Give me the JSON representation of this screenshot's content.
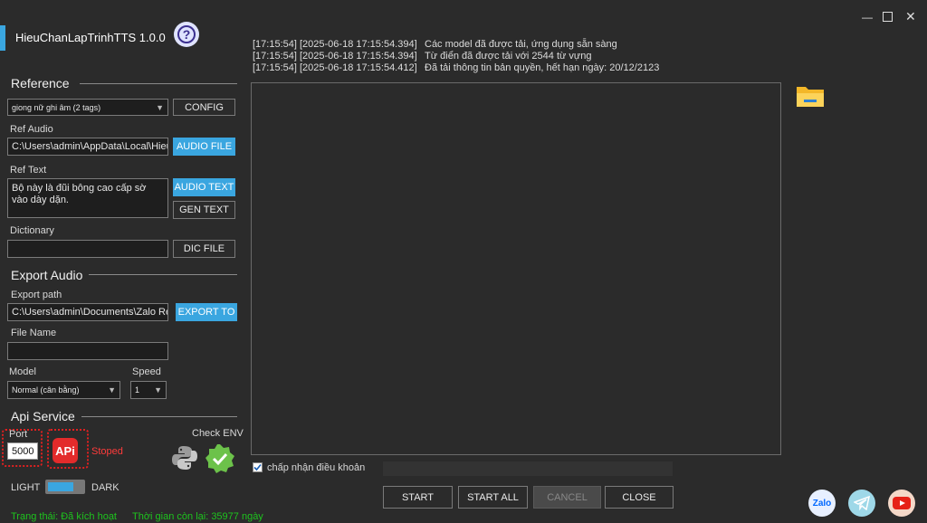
{
  "app": {
    "title": "HieuChanLapTrinhTTS 1.0.0"
  },
  "reference": {
    "heading": "Reference",
    "voice_select": "giong nữ ghi âm (2 tags)",
    "config_btn": "CONFIG",
    "ref_audio_label": "Ref Audio",
    "ref_audio_value": "C:\\Users\\admin\\AppData\\Local\\Hieu(",
    "audio_file_btn": "AUDIO FILE",
    "ref_text_label": "Ref Text",
    "ref_text_value": "Bộ này là đũi bông cao cấp sờ vào dày dặn.",
    "audio_text_btn": "AUDIO TEXT",
    "gen_text_btn": "GEN TEXT",
    "dictionary_label": "Dictionary",
    "dictionary_value": "",
    "dic_file_btn": "DIC FILE"
  },
  "export": {
    "heading": "Export Audio",
    "path_label": "Export path",
    "path_value": "C:\\Users\\admin\\Documents\\Zalo Rec",
    "export_to_btn": "EXPORT TO",
    "file_name_label": "File Name",
    "file_name_value": "",
    "model_label": "Model",
    "model_value": "Normal (cân bằng)",
    "speed_label": "Speed",
    "speed_value": "1"
  },
  "api": {
    "heading": "Api Service",
    "port_label": "Port",
    "port_value": "5000",
    "api_icon_text": "APi",
    "status": "Stoped",
    "check_env_label": "Check ENV"
  },
  "theme": {
    "light": "LIGHT",
    "dark": "DARK"
  },
  "status_bar": {
    "status": "Trạng thái: Đã kích hoạt",
    "time_left": "Thời gian còn lại: 35977 ngày"
  },
  "log": [
    {
      "time": "[17:15:54] [2025-06-18 17:15:54.394]",
      "msg": "Các model đã được tải, ứng dụng sẵn sàng"
    },
    {
      "time": "[17:15:54] [2025-06-18 17:15:54.394]",
      "msg": "Từ điển đã được tải với 2544 từ vựng"
    },
    {
      "time": "[17:15:54] [2025-06-18 17:15:54.412]",
      "msg": "Đã tải thông tin bản quyền, hết hạn ngày: 20/12/2123"
    }
  ],
  "terms": {
    "label": "chấp nhận điều khoản",
    "checked": true
  },
  "actions": {
    "start": "START",
    "start_all": "START ALL",
    "cancel": "CANCEL",
    "close": "CLOSE"
  },
  "social": {
    "zalo": "Zalo"
  },
  "colors": {
    "accent": "#3aa6e0",
    "background": "#2b2b2b",
    "error": "#ff3b3b",
    "success": "#1ec41e"
  }
}
